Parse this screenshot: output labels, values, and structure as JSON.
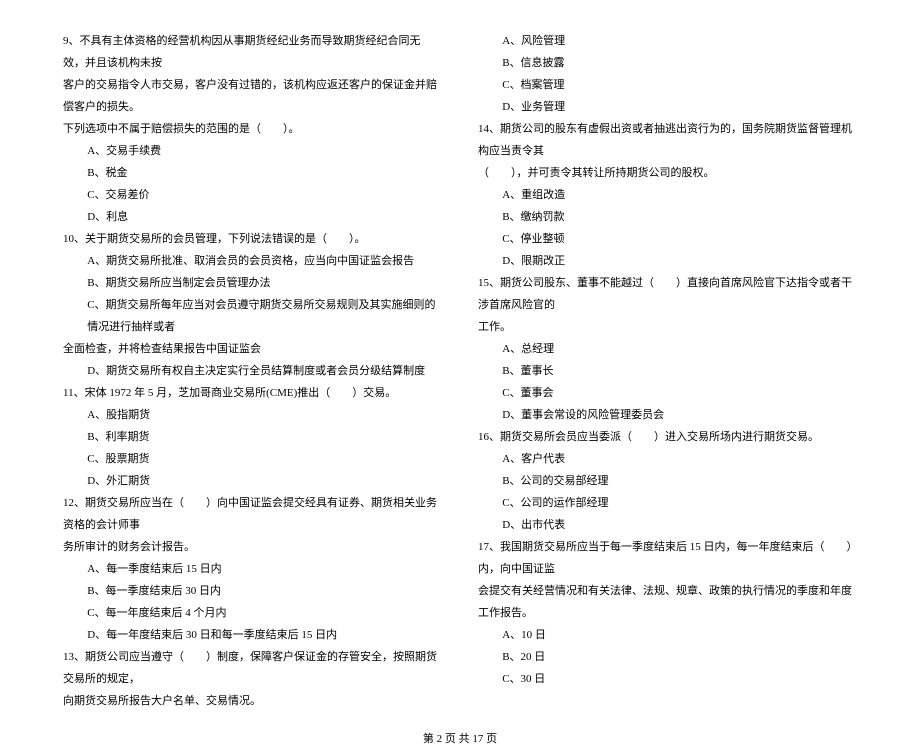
{
  "left": {
    "q9": {
      "stem1": "9、不具有主体资格的经营机构因从事期货经纪业务而导致期货经纪合同无效，并且该机构未按",
      "stem2": "客户的交易指令人市交易，客户没有过错的，该机构应返还客户的保证金并赔偿客户的损失。",
      "stem3": "下列选项中不属于赔偿损失的范围的是（　　）。",
      "A": "A、交易手续费",
      "B": "B、税金",
      "C": "C、交易差价",
      "D": "D、利息"
    },
    "q10": {
      "stem": "10、关于期货交易所的会员管理，下列说法错误的是（　　）。",
      "A": "A、期货交易所批准、取消会员的会员资格，应当向中国证监会报告",
      "B": "B、期货交易所应当制定会员管理办法",
      "C1": "C、期货交易所每年应当对会员遵守期货交易所交易规则及其实施细则的情况进行抽样或者",
      "C2": "全面检查，并将检查结果报告中国证监会",
      "D": "D、期货交易所有权自主决定实行全员结算制度或者会员分级结算制度"
    },
    "q11": {
      "stem": "11、宋体 1972 年 5 月，芝加哥商业交易所(CME)推出（　　）交易。",
      "A": "A、股指期货",
      "B": "B、利率期货",
      "C": "C、股票期货",
      "D": "D、外汇期货"
    },
    "q12": {
      "stem1": "12、期货交易所应当在（　　）向中国证监会提交经具有证券、期货相关业务资格的会计师事",
      "stem2": "务所审计的财务会计报告。",
      "A": "A、每一季度结束后 15 日内",
      "B": "B、每一季度结束后 30 日内",
      "C": "C、每一年度结束后 4 个月内",
      "D": "D、每一年度结束后 30 日和每一季度结束后 15 日内"
    },
    "q13": {
      "stem1": "13、期货公司应当遵守（　　）制度，保障客户保证金的存管安全，按照期货交易所的规定，",
      "stem2": "向期货交易所报告大户名单、交易情况。"
    }
  },
  "right": {
    "q13opts": {
      "A": "A、风险管理",
      "B": "B、信息披露",
      "C": "C、档案管理",
      "D": "D、业务管理"
    },
    "q14": {
      "stem1": "14、期货公司的股东有虚假出资或者抽逃出资行为的，国务院期货监督管理机构应当责令其",
      "stem2": "（　　），并可责令其转让所持期货公司的股权。",
      "A": "A、重组改造",
      "B": "B、缴纳罚款",
      "C": "C、停业整顿",
      "D": "D、限期改正"
    },
    "q15": {
      "stem1": "15、期货公司股东、董事不能越过（　　）直接向首席风险官下达指令或者干涉首席风险官的",
      "stem2": "工作。",
      "A": "A、总经理",
      "B": "B、董事长",
      "C": "C、董事会",
      "D": "D、董事会常设的风险管理委员会"
    },
    "q16": {
      "stem": "16、期货交易所会员应当委派（　　）进入交易所场内进行期货交易。",
      "A": "A、客户代表",
      "B": "B、公司的交易部经理",
      "C": "C、公司的运作部经理",
      "D": "D、出市代表"
    },
    "q17": {
      "stem1": "17、我国期货交易所应当于每一季度结束后 15 日内，每一年度结束后（　　）内，向中国证监",
      "stem2": "会提交有关经营情况和有关法律、法规、规章、政策的执行情况的季度和年度工作报告。",
      "A": "A、10 日",
      "B": "B、20 日",
      "C": "C、30 日"
    }
  },
  "footer": "第 2 页 共 17 页"
}
